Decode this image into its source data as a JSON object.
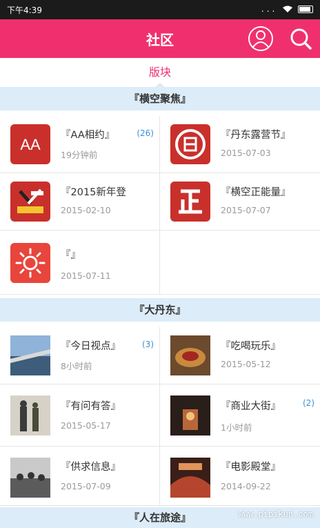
{
  "status_bar": {
    "time": "下午4:39",
    "signal": "...",
    "wifi_icon": "wifi-icon",
    "battery_icon": "battery-icon"
  },
  "header": {
    "title": "社区",
    "user_icon": "user-icon",
    "search_icon": "search-icon"
  },
  "tab": {
    "label": "版块"
  },
  "colors": {
    "brand": "#f0306e",
    "section_bg": "#dcecf8",
    "badge": "#3a8fd8",
    "icon_red": "#c9302c"
  },
  "sections": [
    {
      "title": "『横空聚焦』",
      "items": [
        {
          "name": "『AA相约』",
          "sub": "19分钟前",
          "badge": "(26)",
          "icon": "aa-icon"
        },
        {
          "name": "『丹东露营节』",
          "sub": "2015-07-03",
          "badge": "",
          "icon": "camp-emblem-icon"
        },
        {
          "name": "『2015新年登",
          "sub": "2015-02-10",
          "badge": "",
          "icon": "new-year-icon"
        },
        {
          "name": "『横空正能量』",
          "sub": "2015-07-07",
          "badge": "",
          "icon": "zheng-icon"
        },
        {
          "name": "『』",
          "sub": "2015-07-11",
          "badge": "",
          "icon": "sun-icon"
        }
      ]
    },
    {
      "title": "『大丹东』",
      "items": [
        {
          "name": "『今日视点』",
          "sub": "8小时前",
          "badge": "(3)",
          "icon": "photo-bridge"
        },
        {
          "name": "『吃喝玩乐』",
          "sub": "2015-05-12",
          "badge": "",
          "icon": "photo-food"
        },
        {
          "name": "『有问有答』",
          "sub": "2015-05-17",
          "badge": "",
          "icon": "photo-people"
        },
        {
          "name": "『商业大街』",
          "sub": "1小时前",
          "badge": "(2)",
          "icon": "photo-street"
        },
        {
          "name": "『供求信息』",
          "sub": "2015-07-09",
          "badge": "",
          "icon": "photo-crowd"
        },
        {
          "name": "『电影殿堂』",
          "sub": "2014-09-22",
          "badge": "",
          "icon": "photo-cinema"
        }
      ]
    },
    {
      "title": "『人在旅途』",
      "items": []
    }
  ],
  "watermark": "www.pipikun.com"
}
